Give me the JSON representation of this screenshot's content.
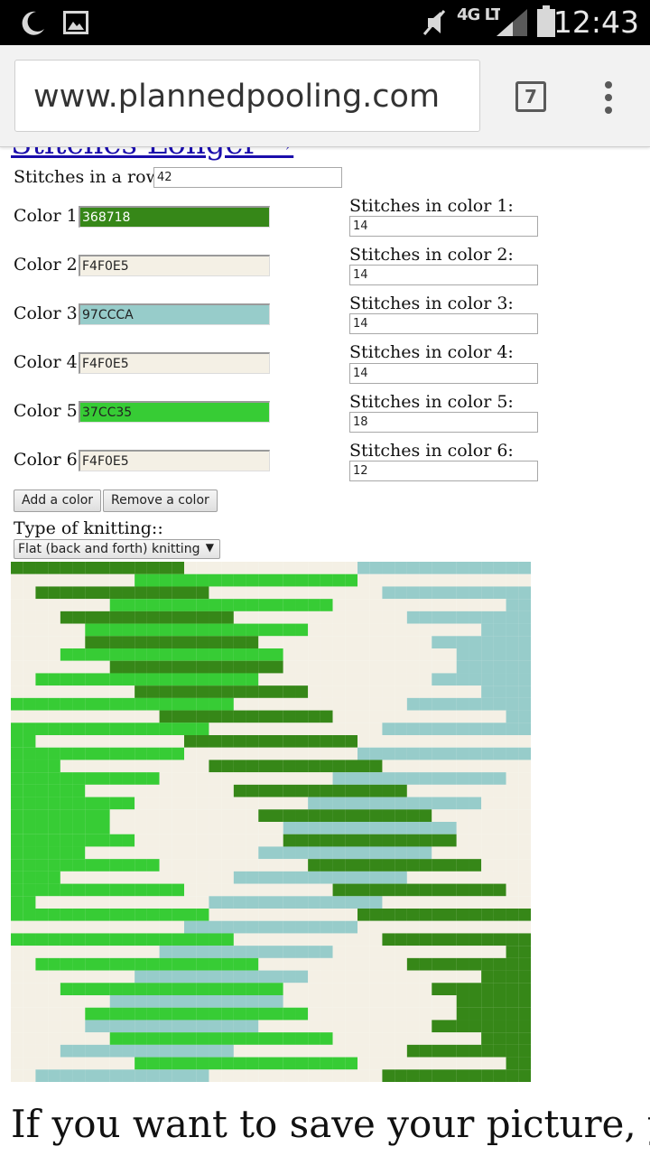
{
  "status_bar": {
    "time": "12:43",
    "network": "4G LTE",
    "icons": [
      "moon-icon",
      "image-icon",
      "mute-icon",
      "signal-icon",
      "battery-icon"
    ]
  },
  "browser": {
    "url": "www.plannedpooling.com",
    "tab_count": "7"
  },
  "page": {
    "cut_link": "Stitches Longer →",
    "stitches_in_row_label": "Stitches in a row:",
    "stitches_in_row_value": "42",
    "colors": [
      {
        "label": "Color 1:",
        "hex": "368718",
        "count_label": "Stitches in color 1:",
        "count": "14"
      },
      {
        "label": "Color 2:",
        "hex": "F4F0E5",
        "count_label": "Stitches in color 2:",
        "count": "14"
      },
      {
        "label": "Color 3:",
        "hex": "97CCCA",
        "count_label": "Stitches in color 3:",
        "count": "14"
      },
      {
        "label": "Color 4:",
        "hex": "F4F0E5",
        "count_label": "Stitches in color 4:",
        "count": "14"
      },
      {
        "label": "Color 5:",
        "hex": "37CC35",
        "count_label": "Stitches in color 5:",
        "count": "18"
      },
      {
        "label": "Color 6:",
        "hex": "F4F0E5",
        "count_label": "Stitches in color 6:",
        "count": "12"
      }
    ],
    "add_color_button": "Add a color",
    "remove_color_button": "Remove a color",
    "knitting_type_label": "Type of knitting::",
    "knitting_type_value": "Flat (back and forth) knitting",
    "footer_text": "If you want to save your picture, you"
  }
}
